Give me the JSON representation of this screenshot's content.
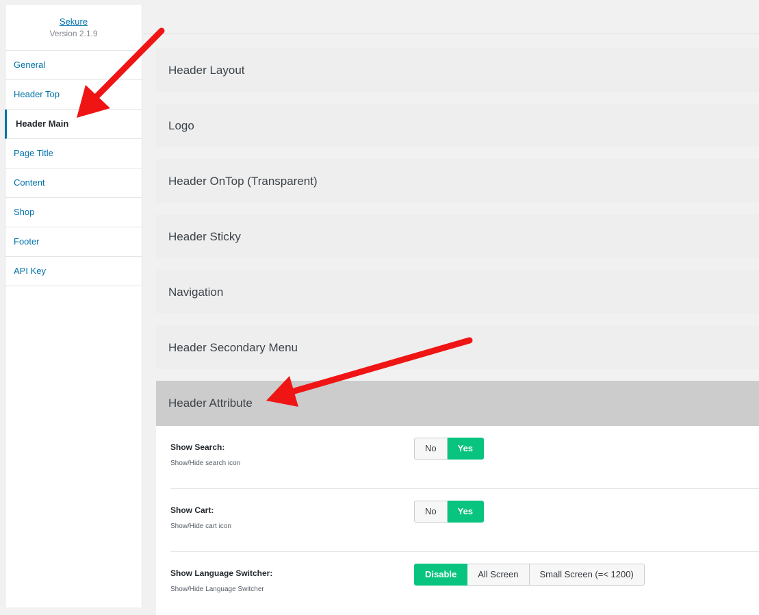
{
  "brand": {
    "name": "Sekure",
    "version": "Version 2.1.9"
  },
  "sidebar": {
    "items": [
      {
        "label": "General"
      },
      {
        "label": "Header Top"
      },
      {
        "label": "Header Main"
      },
      {
        "label": "Page Title"
      },
      {
        "label": "Content"
      },
      {
        "label": "Shop"
      },
      {
        "label": "Footer"
      },
      {
        "label": "API Key"
      }
    ],
    "active_index": 2
  },
  "sections": [
    {
      "title": "Header Layout"
    },
    {
      "title": "Logo"
    },
    {
      "title": "Header OnTop (Transparent)"
    },
    {
      "title": "Header Sticky"
    },
    {
      "title": "Navigation"
    },
    {
      "title": "Header Secondary Menu"
    },
    {
      "title": "Header Attribute"
    }
  ],
  "fields": {
    "show_search": {
      "label": "Show Search:",
      "desc": "Show/Hide search icon",
      "options": [
        "No",
        "Yes"
      ],
      "selected": "Yes"
    },
    "show_cart": {
      "label": "Show Cart:",
      "desc": "Show/Hide cart icon",
      "options": [
        "No",
        "Yes"
      ],
      "selected": "Yes"
    },
    "show_language_switcher": {
      "label": "Show Language Switcher:",
      "desc": "Show/Hide Language Switcher",
      "options": [
        "Disable",
        "All Screen",
        "Small Screen (=< 1200)"
      ],
      "selected": "Disable"
    }
  },
  "colors": {
    "accent": "#0073aa",
    "toggle_on": "#09c47f",
    "annotation_arrow": "#f01515"
  }
}
